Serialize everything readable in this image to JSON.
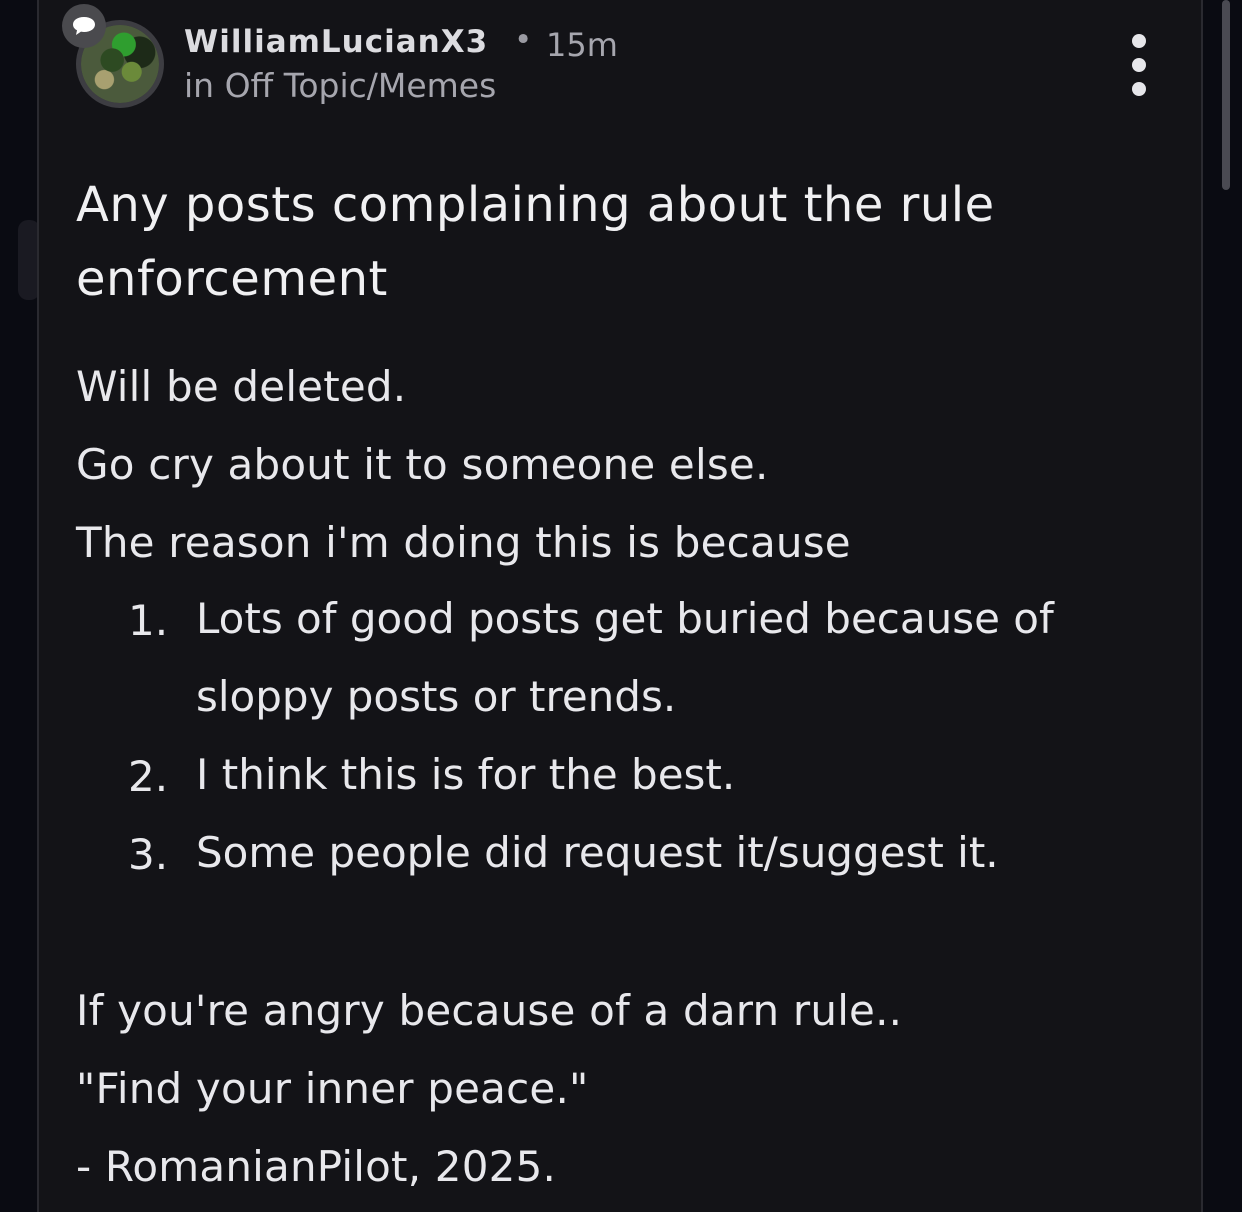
{
  "post": {
    "author": "WilliamLucianX3",
    "separator": "•",
    "time": "15m",
    "community": "in Off Topic/Memes",
    "title": "Any posts complaining about the rule enforcement",
    "body": {
      "line1": "Will be deleted.",
      "line2": "Go cry about it to someone else.",
      "line3": "The reason i'm doing this is because",
      "list": [
        {
          "num": "1.",
          "text": "Lots of good posts get buried because of sloppy posts or trends."
        },
        {
          "num": "2.",
          "text": "I think this is for the best."
        },
        {
          "num": "3.",
          "text": "Some people did request it/suggest it."
        }
      ],
      "line4": "If you're angry because of a darn rule..",
      "line5": "\"Find your inner peace.\"",
      "line6": "- RomanianPilot, 2025."
    }
  },
  "icons": {
    "more": "more-vertical-icon",
    "badge": "chat-bubble-icon"
  },
  "colors": {
    "background": "#0a0b12",
    "card": "#131317",
    "text": "#e8e8ec",
    "muted": "#a6a6ae"
  }
}
